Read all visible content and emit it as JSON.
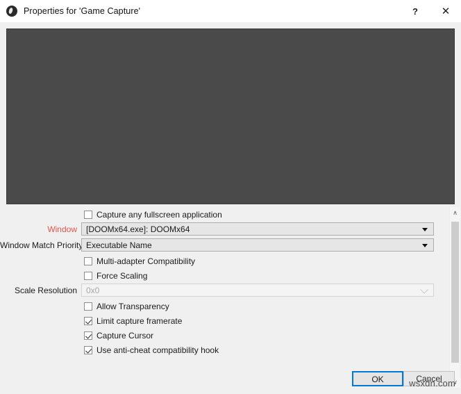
{
  "window": {
    "title": "Properties for 'Game Capture'",
    "icon": "obs-logo-icon",
    "help_label": "?",
    "close_label": "✕"
  },
  "preview": {
    "name": "capture-preview",
    "background_color": "#4a4a4a"
  },
  "form": {
    "rows": [
      {
        "type": "checkbox",
        "name": "capture-any-fullscreen-application",
        "label": "Capture any fullscreen application",
        "checked": false
      },
      {
        "type": "combobox",
        "name": "window",
        "label": "Window",
        "label_color": "#e8544c",
        "value": "[DOOMx64.exe]: DOOMx64",
        "enabled": true
      },
      {
        "type": "combobox",
        "name": "window-match-priority",
        "label": "Window Match Priority",
        "value": "Executable Name",
        "enabled": true
      },
      {
        "type": "checkbox",
        "name": "multi-adapter-compatibility",
        "label": "Multi-adapter Compatibility",
        "checked": false
      },
      {
        "type": "checkbox",
        "name": "force-scaling",
        "label": "Force Scaling",
        "checked": false
      },
      {
        "type": "combobox",
        "name": "scale-resolution",
        "label": "Scale Resolution",
        "value": "0x0",
        "enabled": false
      },
      {
        "type": "checkbox",
        "name": "allow-transparency",
        "label": "Allow Transparency",
        "checked": false
      },
      {
        "type": "checkbox",
        "name": "limit-capture-framerate",
        "label": "Limit capture framerate",
        "checked": true
      },
      {
        "type": "checkbox",
        "name": "capture-cursor",
        "label": "Capture Cursor",
        "checked": true
      },
      {
        "type": "checkbox",
        "name": "use-anti-cheat-compatibility-hook",
        "label": "Use anti-cheat compatibility hook",
        "checked": true
      }
    ]
  },
  "scrollbar": {
    "up_arrow": "∧",
    "down_arrow": "∨"
  },
  "buttons": {
    "ok": "OK",
    "cancel": "Cancel"
  },
  "watermark": "wsxdn.com",
  "colors": {
    "accent": "#0078d7",
    "required_label": "#e8544c",
    "preview": "#4a4a4a",
    "dialog_background": "#f0f0f0"
  }
}
